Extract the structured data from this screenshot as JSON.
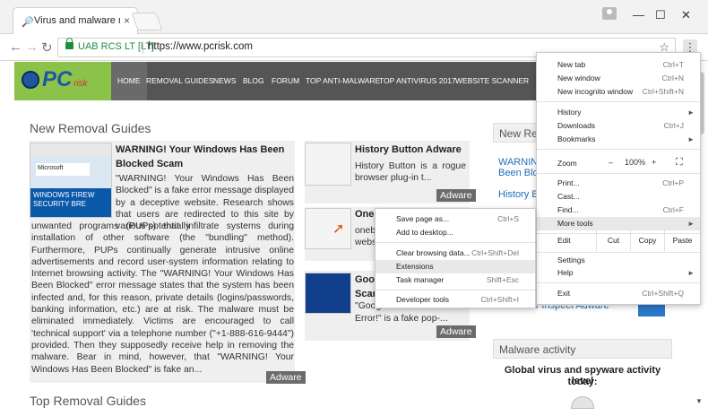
{
  "browser": {
    "tab_title": "Virus and malware remo",
    "close_glyph": "×",
    "window_controls": {
      "minimize": "—",
      "maximize": "☐",
      "close": "✕"
    },
    "nav": {
      "back": "←",
      "forward": "→",
      "reload": "↻"
    },
    "cert_label": "UAB RCS LT [LT]",
    "url": "https://www.pcrisk.com",
    "star": "☆",
    "menu_glyph": "⋮"
  },
  "site": {
    "logo_main": "PC",
    "logo_sub": "risk",
    "nav": [
      "HOME",
      "REMOVAL GUIDES",
      "NEWS",
      "BLOG",
      "FORUM",
      "TOP ANTI-MALWARE",
      "TOP ANTIVIRUS 2017",
      "WEBSITE SCANNER"
    ],
    "section_new": "New Removal Guides",
    "section_top": "Top Removal Guides",
    "featured": {
      "title": "WARNING! Your Windows Has Been Blocked Scam",
      "excerpt_top": "\"WARNING! Your Windows Has Been Blocked\" is a fake error message displayed by a deceptive website. Research shows that users are redirected to this site by various potentially",
      "excerpt_rest": "unwanted programs (PUPs) that infiltrate systems during installation of other software (the \"bundling\" method). Furthermore, PUPs continually generate intrusive online advertisements and record user-system information relating to Internet browsing activity. The \"WARNING! Your Windows Has Been Blocked\" error message states that the system has been infected and, for this reason, private details (logins/passwords, banking information, etc.) are at risk. The malware must be eliminated immediately. Victims are encouraged to call 'technical support' via a telephone number (\"+1-888-616-9444\") provided. Then they supposedly receive help in removing the malware. Bear in mind, however, that \"WARNING! Your Windows Has Been Blocked\" is fake an...",
      "badge": "Adware",
      "thumb_text": "WINDOWS FIREW SECURITY BRE",
      "thumb_label": "Microsoft"
    },
    "mid_cards": [
      {
        "title": "History Button Adware",
        "excerpt": "History Button is a rogue browser plug-in t...",
        "badge": "Adware"
      },
      {
        "title": "Onebr",
        "excerpt": "onebr webs",
        "badge": ""
      },
      {
        "title": "Googl Scam",
        "excerpt_line1": "\"Google Chrome Fatal",
        "excerpt_line2": "Error!\" is a fake pop-...",
        "badge": "Adware"
      }
    ],
    "sidebar": {
      "head": "New Rem",
      "links": [
        "WARNING",
        "Been Block",
        "History Bu"
      ],
      "bottom_link": "Weather Inspect Adware",
      "malware_head": "Malware activity",
      "malware_text_1": "Global virus and spyware activity level",
      "malware_text_2": "today:"
    }
  },
  "chrome_menu": {
    "items": [
      {
        "label": "New tab",
        "shortcut": "Ctrl+T"
      },
      {
        "label": "New window",
        "shortcut": "Ctrl+N"
      },
      {
        "label": "New incognito window",
        "shortcut": "Ctrl+Shift+N"
      },
      {
        "label": "History",
        "shortcut": ""
      },
      {
        "label": "Downloads",
        "shortcut": "Ctrl+J"
      },
      {
        "label": "Bookmarks",
        "shortcut": ""
      },
      {
        "label": "Print...",
        "shortcut": "Ctrl+P"
      },
      {
        "label": "Cast...",
        "shortcut": ""
      },
      {
        "label": "Find...",
        "shortcut": "Ctrl+F"
      },
      {
        "label": "More tools",
        "shortcut": ""
      },
      {
        "label": "Settings",
        "shortcut": ""
      },
      {
        "label": "Help",
        "shortcut": ""
      },
      {
        "label": "Exit",
        "shortcut": "Ctrl+Shift+Q"
      }
    ],
    "zoom": {
      "label": "Zoom",
      "minus": "–",
      "value": "100%",
      "plus": "+",
      "fullscreen": "⛶"
    },
    "edit": {
      "label": "Edit",
      "cut": "Cut",
      "copy": "Copy",
      "paste": "Paste"
    },
    "arrow": "►"
  },
  "more_tools_menu": {
    "items": [
      {
        "label": "Save page as...",
        "shortcut": "Ctrl+S"
      },
      {
        "label": "Add to desktop...",
        "shortcut": ""
      },
      {
        "label": "Clear browsing data...",
        "shortcut": "Ctrl+Shift+Del"
      },
      {
        "label": "Extensions",
        "shortcut": ""
      },
      {
        "label": "Task manager",
        "shortcut": "Shift+Esc"
      },
      {
        "label": "Developer tools",
        "shortcut": "Ctrl+Shift+I"
      }
    ]
  },
  "colors": {
    "accent_link": "#1d6fb8",
    "header_bg": "#555555",
    "logo_bg": "#8bc34a",
    "secure_green": "#1e8e3e"
  }
}
